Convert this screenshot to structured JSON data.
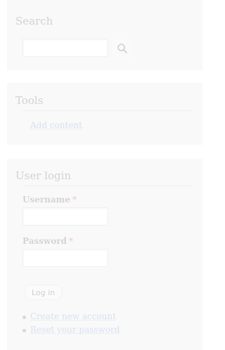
{
  "search_block": {
    "title": "Search",
    "input_value": "",
    "button_icon": "search-icon"
  },
  "tools_block": {
    "title": "Tools",
    "links": [
      "Add content"
    ]
  },
  "login_block": {
    "title": "User login",
    "username_label": "Username",
    "password_label": "Password",
    "required_marker": "*",
    "username_value": "",
    "password_value": "",
    "submit_label": "Log in",
    "links": [
      "Create new account",
      "Reset your password"
    ]
  },
  "colors": {
    "link": "#d8e0f0",
    "required": "#f4c8c8",
    "block_background": "#f9f9f9"
  }
}
